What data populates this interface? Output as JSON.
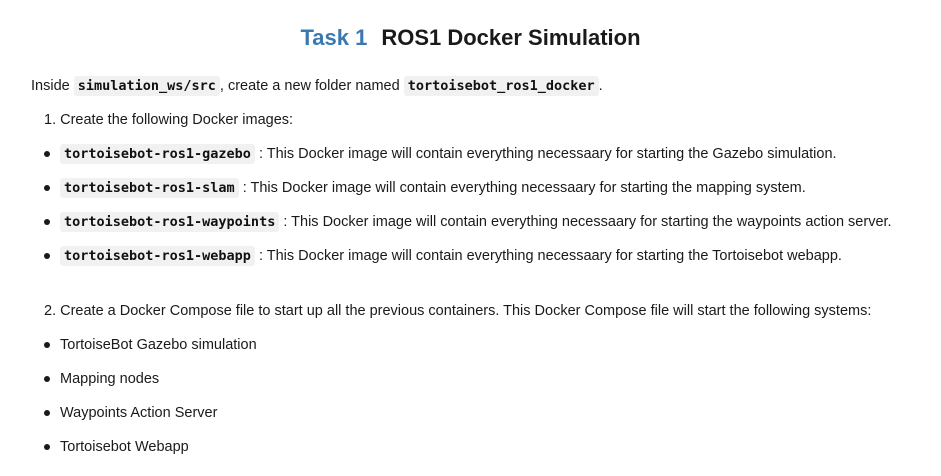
{
  "title": {
    "task": "Task 1",
    "name": "ROS1 Docker Simulation"
  },
  "intro": {
    "before": "Inside ",
    "folder": "simulation_ws/src",
    "middle": ", create a new folder named ",
    "new_folder": "tortoisebot_ros1_docker",
    "after": "."
  },
  "step1": {
    "text": "1. Create the following Docker images:",
    "images": [
      {
        "name": "tortoisebot-ros1-gazebo",
        "desc": ": This Docker image will contain everything necessaary for starting the Gazebo simulation."
      },
      {
        "name": "tortoisebot-ros1-slam",
        "desc": ": This Docker image will contain everything necessaary for starting the mapping system."
      },
      {
        "name": "tortoisebot-ros1-waypoints",
        "desc": ": This Docker image will contain everything necessaary for starting the waypoints action server."
      },
      {
        "name": "tortoisebot-ros1-webapp",
        "desc": ": This Docker image will contain everything necessaary for starting the Tortoisebot webapp."
      }
    ]
  },
  "step2": {
    "text": "2. Create a Docker Compose file to start up all the previous containers. This Docker Compose file will start the following systems:",
    "systems": [
      "TortoiseBot Gazebo simulation",
      "Mapping nodes",
      "Waypoints Action Server",
      "Tortoisebot Webapp"
    ]
  }
}
